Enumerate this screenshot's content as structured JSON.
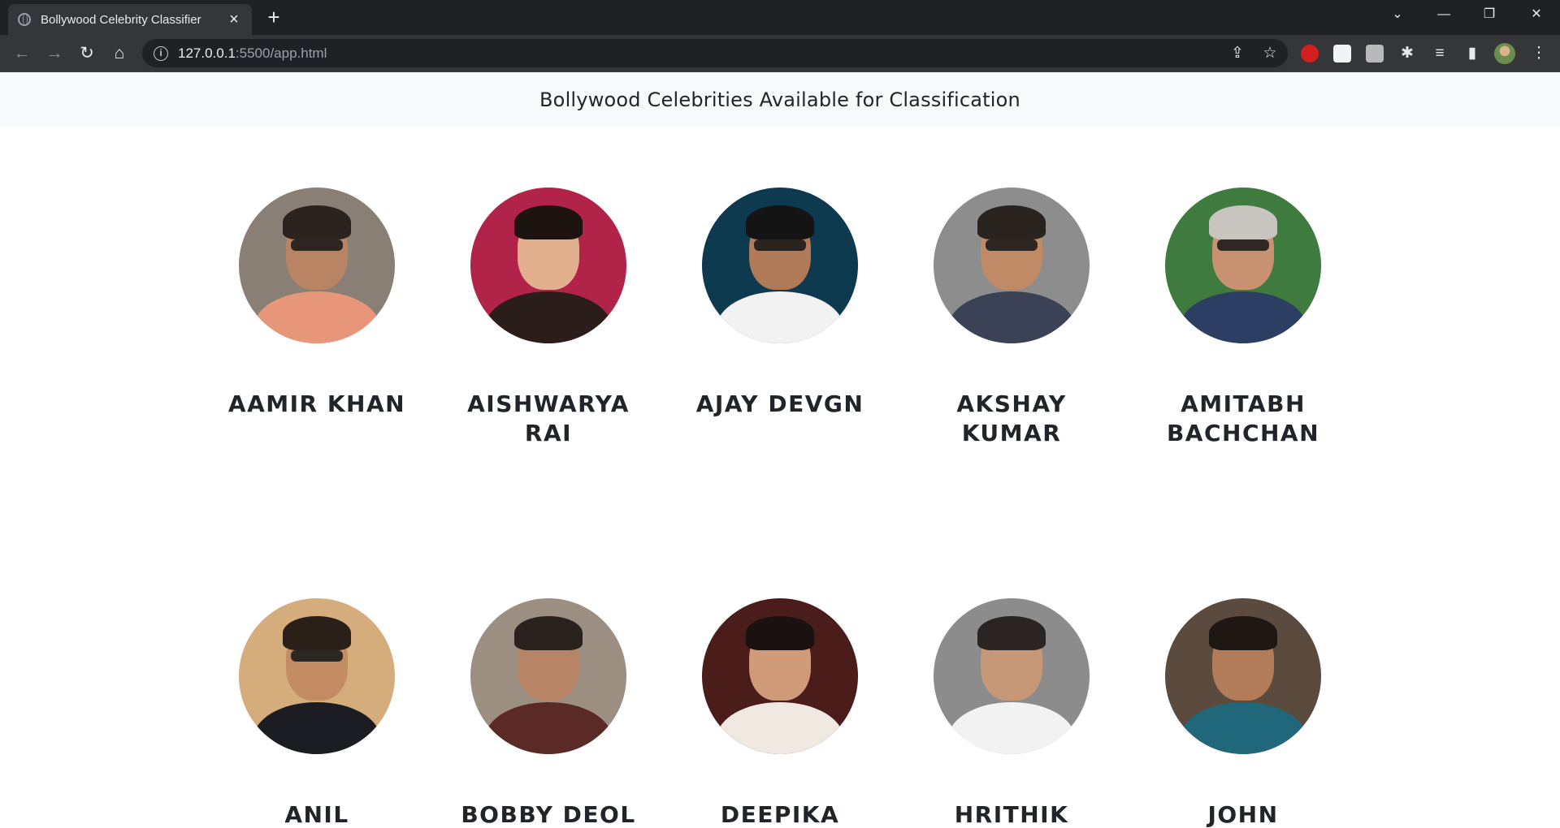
{
  "browser": {
    "tab_title": "Bollywood Celebrity Classifier",
    "new_tab_symbol": "+",
    "url_host": "127.0.0.1",
    "url_rest": ":5500/app.html"
  },
  "page": {
    "heading": "Bollywood Celebrities Available for Classification"
  },
  "celebrities": [
    {
      "name": "AAMIR KHAN",
      "bg": "#8a7f74",
      "skin": "#b98463",
      "hair": "#2b2320",
      "top": "#e8967a",
      "glasses": true
    },
    {
      "name": "AISHWARYA RAI",
      "bg": "#b2234a",
      "skin": "#e2b08f",
      "hair": "#1d1412",
      "top": "#2a1d1a",
      "glasses": false
    },
    {
      "name": "AJAY DEVGN",
      "bg": "#0e3a4f",
      "skin": "#b07a58",
      "hair": "#141414",
      "top": "#f2f2f2",
      "glasses": true
    },
    {
      "name": "AKSHAY KUMAR",
      "bg": "#8d8d8d",
      "skin": "#c08a66",
      "hair": "#2a2420",
      "top": "#3b4256",
      "glasses": true
    },
    {
      "name": "AMITABH BACHCHAN",
      "bg": "#3f7a3e",
      "skin": "#c89272",
      "hair": "#c8c4c0",
      "top": "#2c3f63",
      "glasses": true
    },
    {
      "name": "ANIL",
      "bg": "#d5ad7c",
      "skin": "#c48c64",
      "hair": "#2b2019",
      "top": "#1c1d22",
      "glasses": true
    },
    {
      "name": "BOBBY DEOL",
      "bg": "#9c8f82",
      "skin": "#b78465",
      "hair": "#2a221e",
      "top": "#5c2a26",
      "glasses": false
    },
    {
      "name": "DEEPIKA",
      "bg": "#4a1d1a",
      "skin": "#cf9a78",
      "hair": "#1a1210",
      "top": "#efe9e2",
      "glasses": false
    },
    {
      "name": "HRITHIK",
      "bg": "#8c8c8c",
      "skin": "#c79877",
      "hair": "#2a2422",
      "top": "#f2f2f2",
      "glasses": false
    },
    {
      "name": "JOHN",
      "bg": "#5b4a3e",
      "skin": "#b27c5a",
      "hair": "#1e1815",
      "top": "#21677a",
      "glasses": false
    }
  ]
}
